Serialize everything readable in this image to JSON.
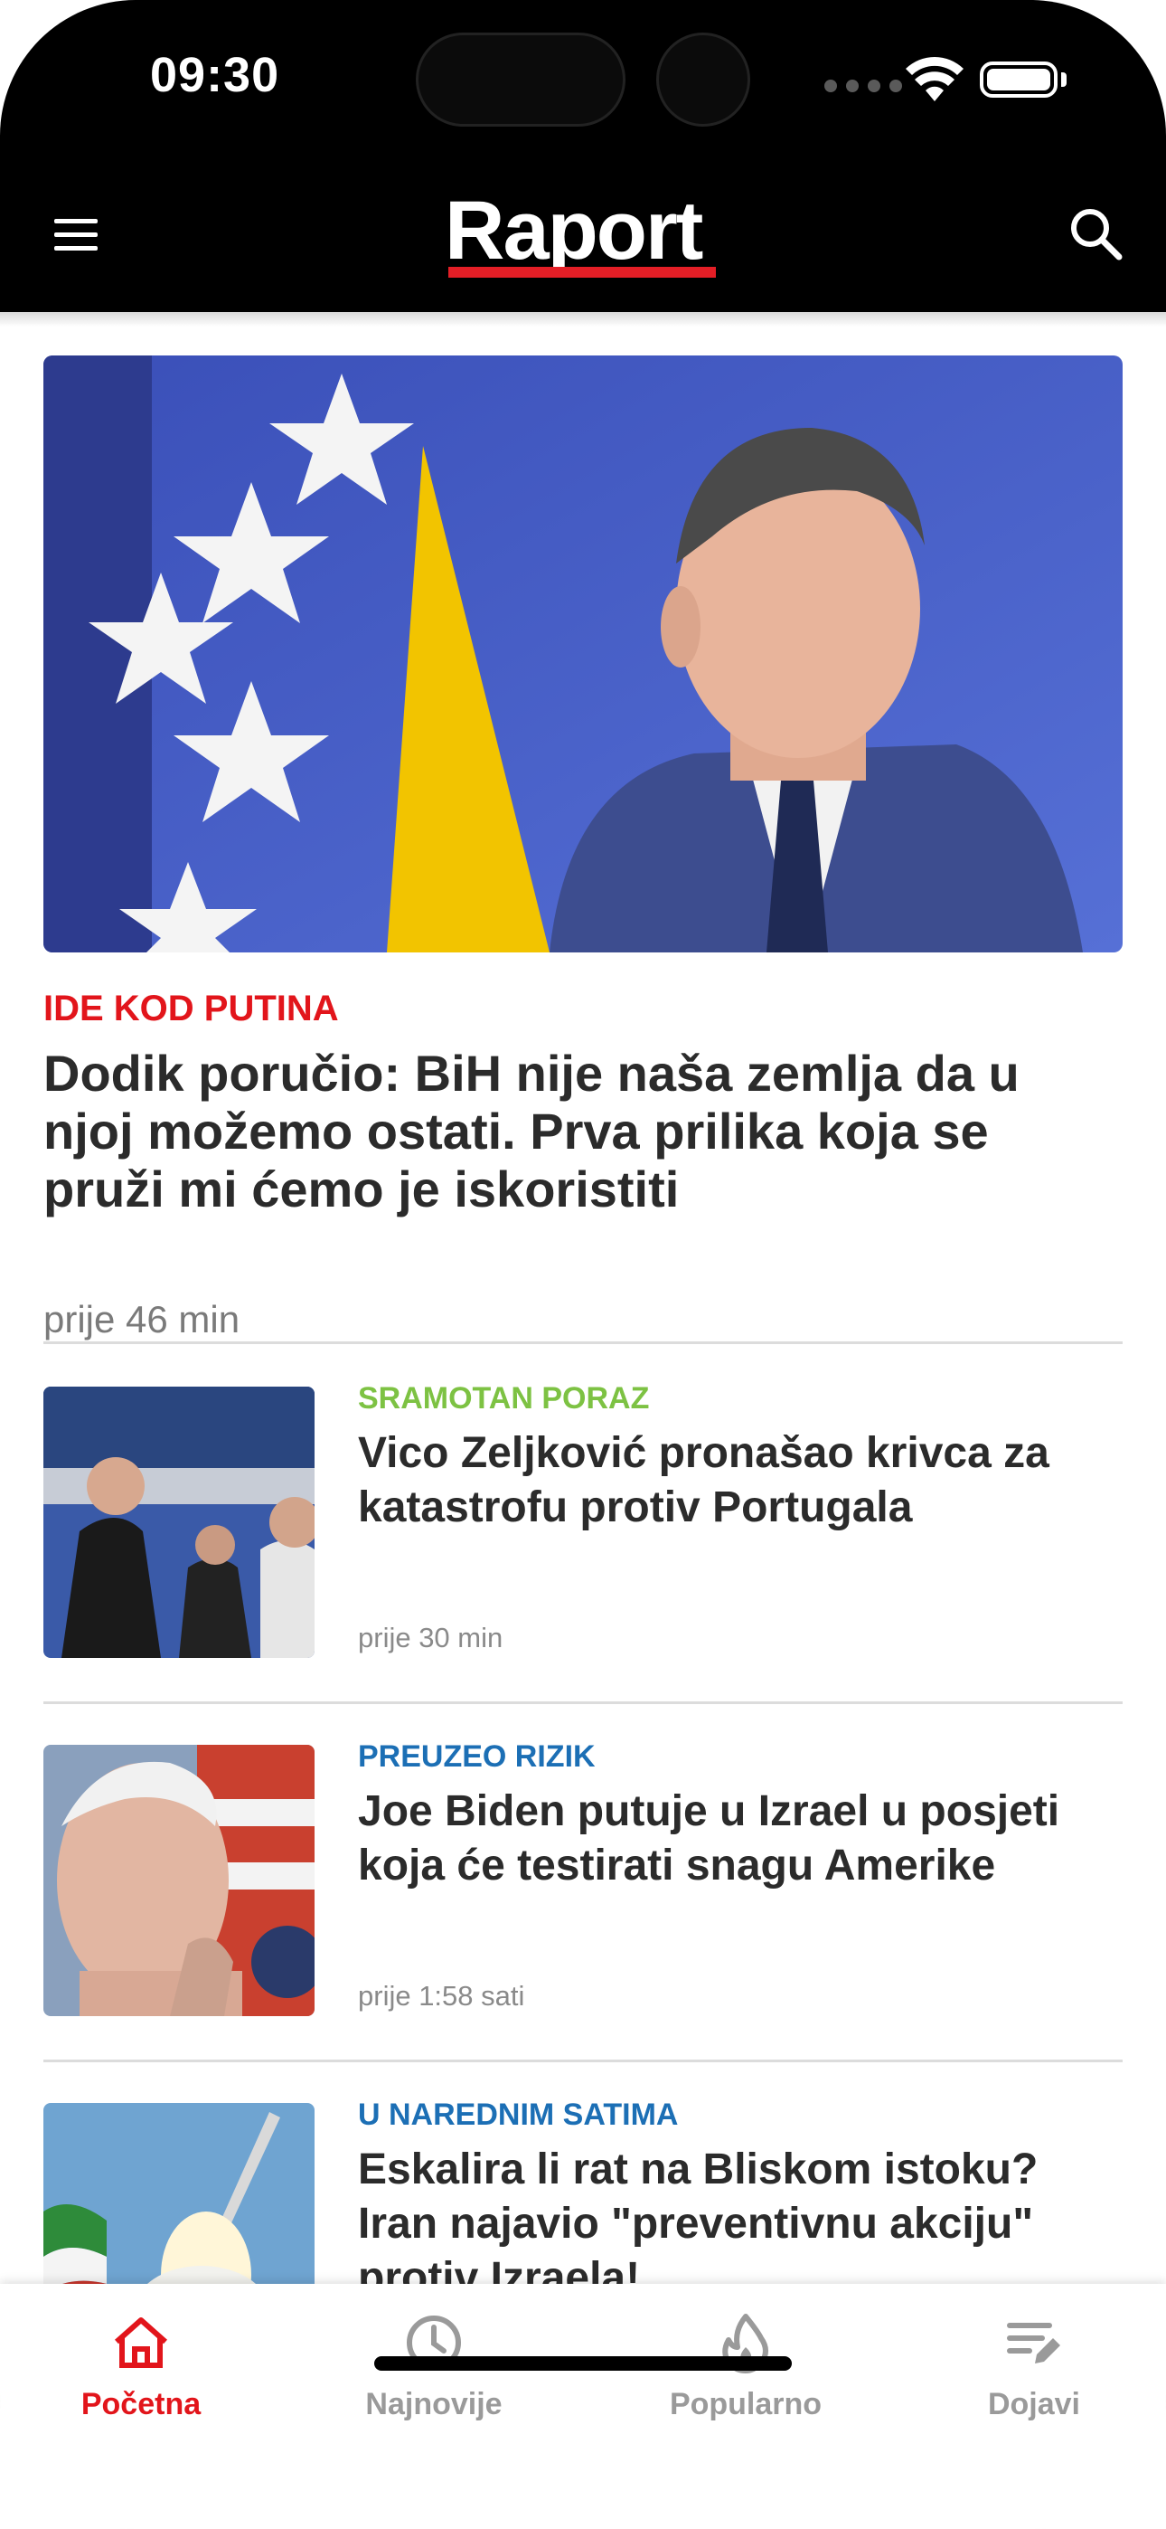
{
  "status_bar": {
    "time": "09:30"
  },
  "header": {
    "logo_text": "Raport",
    "brand_color": "#e41e26"
  },
  "hero": {
    "kicker": "IDE KOD PUTINA",
    "kicker_color": "#e2151b",
    "title": "Dodik poručio: BiH nije naša zemlja da u njoj možemo ostati. Prva prilika koja se pruži mi ćemo je iskoristiti",
    "time": "prije 46 min"
  },
  "articles": [
    {
      "kicker": "SRAMOTAN PORAZ",
      "kicker_color": "#7dc243",
      "title": "Vico Zeljković pronašao krivca za katastrofu protiv Portugala",
      "time": "prije 30 min"
    },
    {
      "kicker": "PREUZEO RIZIK",
      "kicker_color": "#1c6fb5",
      "title": "Joe Biden putuje u Izrael u posjeti koja će testirati snagu Amerike",
      "time": "prije 1:58 sati"
    },
    {
      "kicker": "U NAREDNIM SATIMA",
      "kicker_color": "#1c6fb5",
      "title": "Eskalira li rat na Bliskom istoku? Iran najavio \"preventivnu akciju\" protiv Izraela!",
      "time": ""
    }
  ],
  "tabs": [
    {
      "label": "Početna",
      "icon": "home-icon",
      "active": true
    },
    {
      "label": "Najnovije",
      "icon": "clock-icon",
      "active": false
    },
    {
      "label": "Popularno",
      "icon": "flame-icon",
      "active": false
    },
    {
      "label": "Dojavi",
      "icon": "edit-list-icon",
      "active": false
    }
  ],
  "colors": {
    "active_tab": "#e2151b",
    "inactive_tab": "#9a9a9a"
  }
}
